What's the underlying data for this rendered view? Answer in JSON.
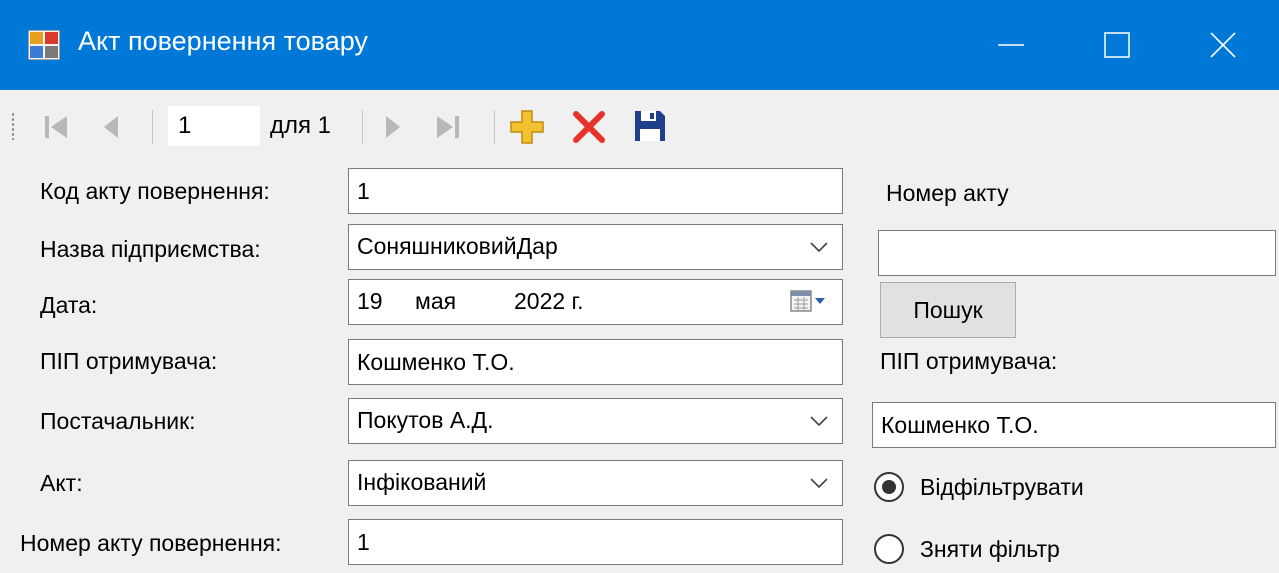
{
  "window": {
    "title": "Акт повернення товару",
    "accent_color": "#0078d7"
  },
  "navigator": {
    "position": "1",
    "count_label": "для 1",
    "icons": [
      "move-first-icon",
      "move-previous-icon",
      "move-next-icon",
      "move-last-icon",
      "add-new-icon",
      "delete-icon",
      "save-icon"
    ]
  },
  "form": {
    "code_label": "Код акту повернення:",
    "code_value": "1",
    "company_label": "Назва підприємства:",
    "company_value": "СоняшниковийДар",
    "date_label": "Дата:",
    "date_day": "19",
    "date_month": "мая",
    "date_year": "2022 г.",
    "recipient_label": "ПІП отримувача:",
    "recipient_value": "Кошменко Т.О.",
    "supplier_label": "Постачальник:",
    "supplier_value": "Покутов А.Д.",
    "act_label": "Акт:",
    "act_value": "Інфікований",
    "act_number_label": "Номер акту повернення:",
    "act_number_value": "1"
  },
  "search": {
    "act_number_label": "Номер акту",
    "act_number_value": "",
    "search_button": "Пошук",
    "recipient_label": "ПІП отримувача:",
    "recipient_value": "Кошменко Т.О.",
    "filter_option": "Відфільтрувати",
    "filter_selected": true,
    "clear_filter_option": "Зняти фільтр"
  }
}
